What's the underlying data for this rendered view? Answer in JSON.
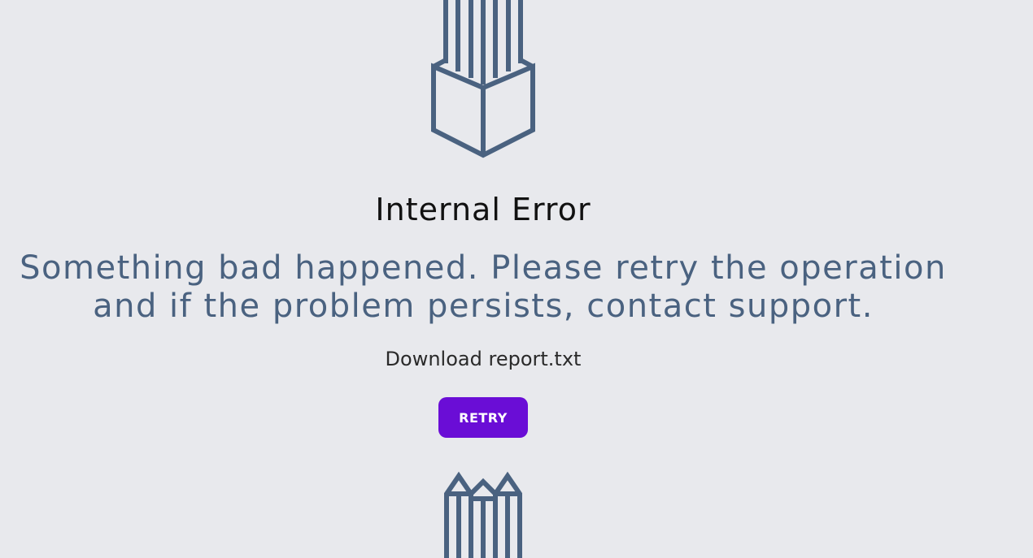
{
  "colors": {
    "background": "#e8e9ed",
    "illustration_stroke": "#4a6280",
    "message_text": "#4a6280",
    "title_text": "#111111",
    "button_background": "#6a0dd6",
    "button_text": "#ffffff"
  },
  "error": {
    "title": "Internal Error",
    "message_line1": "Something bad happened. Please retry the operation",
    "message_line2": "and if the problem persists, contact support.",
    "download_label": "Download report.txt",
    "retry_label": "RETRY"
  },
  "illustration": {
    "top_icon": "pencils-in-cup-icon",
    "bottom_icon": "pencil-tips-icon"
  }
}
